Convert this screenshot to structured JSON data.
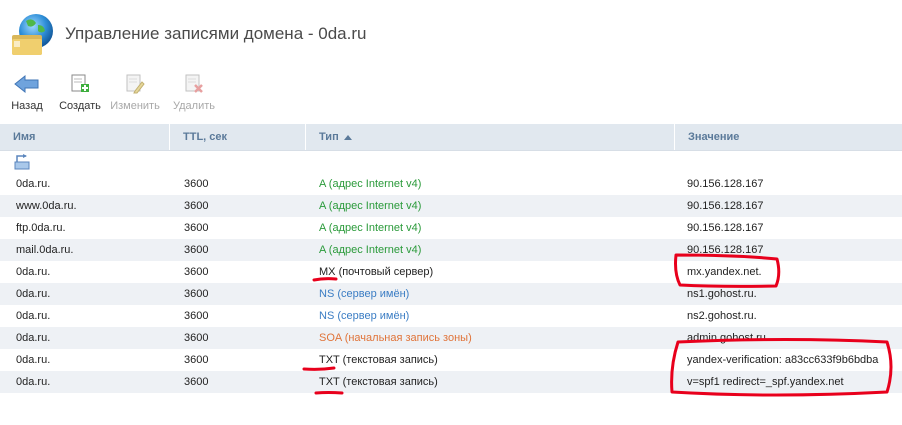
{
  "window": {
    "title": "Управление записями домена - 0da.ru"
  },
  "toolbar": {
    "back_label": "Назад",
    "create_label": "Создать",
    "edit_label": "Изменить",
    "delete_label": "Удалить"
  },
  "table": {
    "headers": {
      "name": "Имя",
      "ttl": "TTL, сек",
      "type": "Тип",
      "value": "Значение"
    },
    "sort_column": "type",
    "sort_direction": "ascending",
    "rows": [
      {
        "name": "0da.ru.",
        "ttl": "3600",
        "type_code": "A",
        "type_desc": "(адрес Internet v4)",
        "value": "90.156.128.167"
      },
      {
        "name": "www.0da.ru.",
        "ttl": "3600",
        "type_code": "A",
        "type_desc": "(адрес Internet v4)",
        "value": "90.156.128.167"
      },
      {
        "name": "ftp.0da.ru.",
        "ttl": "3600",
        "type_code": "A",
        "type_desc": "(адрес Internet v4)",
        "value": "90.156.128.167"
      },
      {
        "name": "mail.0da.ru.",
        "ttl": "3600",
        "type_code": "A",
        "type_desc": "(адрес Internet v4)",
        "value": "90.156.128.167"
      },
      {
        "name": "0da.ru.",
        "ttl": "3600",
        "type_code": "MX",
        "type_desc": "(почтовый сервер)",
        "value": "mx.yandex.net."
      },
      {
        "name": "0da.ru.",
        "ttl": "3600",
        "type_code": "NS",
        "type_desc": "(сервер имён)",
        "value": "ns1.gohost.ru."
      },
      {
        "name": "0da.ru.",
        "ttl": "3600",
        "type_code": "NS",
        "type_desc": "(сервер имён)",
        "value": "ns2.gohost.ru."
      },
      {
        "name": "0da.ru.",
        "ttl": "3600",
        "type_code": "SOA",
        "type_desc": "(начальная запись зоны)",
        "value": "admin.gohost.ru."
      },
      {
        "name": "0da.ru.",
        "ttl": "3600",
        "type_code": "TXT",
        "type_desc": "(текстовая запись)",
        "value": "yandex-verification: a83cc633f9b6bdba"
      },
      {
        "name": "0da.ru.",
        "ttl": "3600",
        "type_code": "TXT",
        "type_desc": "(текстовая запись)",
        "value": "v=spf1 redirect=_spf.yandex.net"
      }
    ]
  },
  "colors": {
    "header_bg": "#e1e8ef",
    "header_text": "#5b7a9a",
    "alt_row_bg": "#eef1f5",
    "type_A": "#2a9a3a",
    "type_NS": "#3b7dc4",
    "type_SOA": "#e0743a",
    "annotation": "#e8001c"
  },
  "icons": {
    "app": "globe-folder-icon",
    "back": "back-arrow-icon",
    "create": "create-record-icon",
    "edit": "edit-record-icon",
    "delete": "delete-record-icon",
    "up": "parent-folder-icon"
  }
}
